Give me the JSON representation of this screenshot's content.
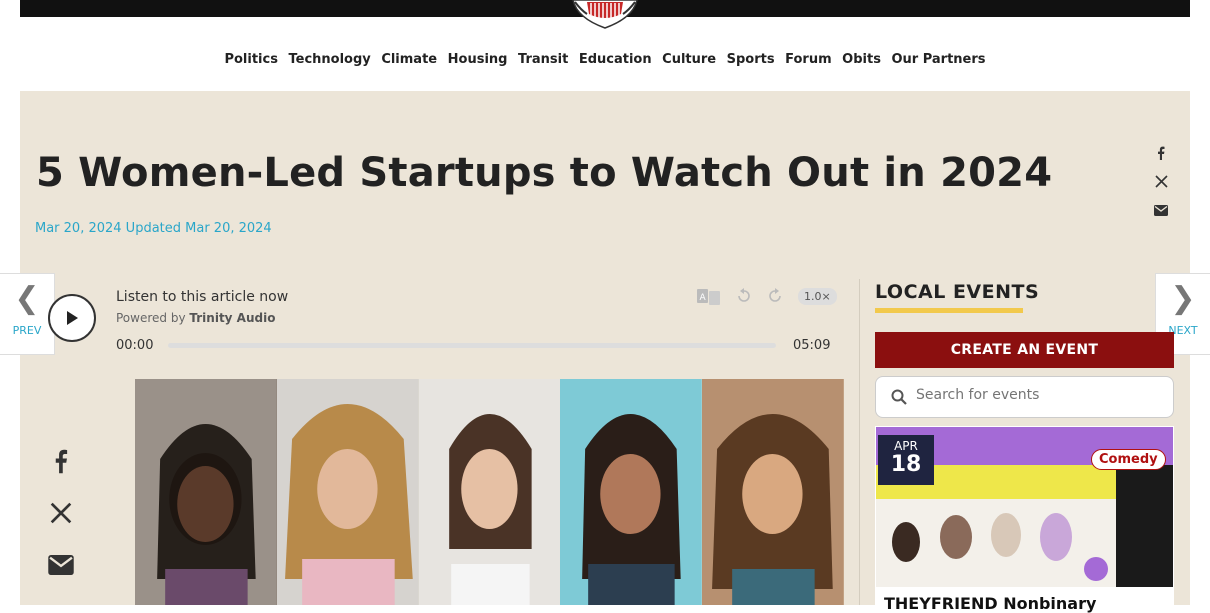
{
  "nav": {
    "items": [
      "Politics",
      "Technology",
      "Climate",
      "Housing",
      "Transit",
      "Education",
      "Culture",
      "Sports",
      "Forum",
      "Obits",
      "Our Partners"
    ]
  },
  "article": {
    "title": "5 Women-Led Startups to Watch Out in 2024",
    "dates": "Mar 20, 2024 Updated Mar 20, 2024"
  },
  "pager": {
    "prev_label": "PREV",
    "next_label": "NEXT"
  },
  "player": {
    "listen_label": "Listen to this article now",
    "powered_prefix": "Powered by",
    "powered_brand": "Trinity Audio",
    "time_current": "00:00",
    "time_total": "05:09",
    "speed": "1.0×",
    "progress": 0
  },
  "events": {
    "heading": "LOCAL EVENTS",
    "create_label": "CREATE AN EVENT",
    "search_placeholder": "Search for events",
    "card": {
      "month": "APR",
      "day": "18",
      "tag": "Comedy",
      "title": "THEYFRIEND Nonbinary"
    }
  },
  "colors": {
    "accent": "#2aa6c9",
    "panel": "#ece5d8",
    "button": "#8b0f0f",
    "underline": "#f2c94c"
  }
}
